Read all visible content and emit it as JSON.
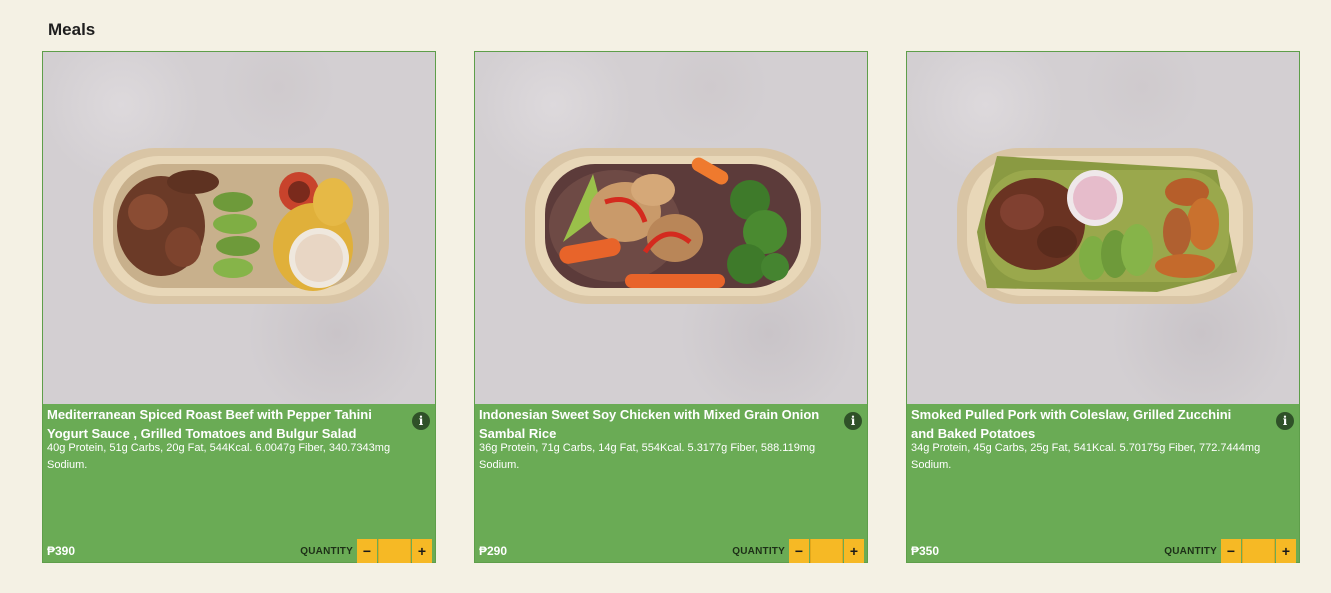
{
  "section": {
    "title": "Meals"
  },
  "meals": [
    {
      "title": "Mediterranean Spiced Roast Beef with Pepper Tahini Yogurt Sauce , Grilled Tomatoes and Bulgur Salad",
      "nutrition": "40g Protein, 51g Carbs, 20g Fat, 544Kcal. 6.0047g Fiber, 340.7343mg Sodium.",
      "price": "₱390",
      "quantity_label": "QUANTITY",
      "quantity_value": "",
      "minus": "−",
      "plus": "+",
      "info": "i"
    },
    {
      "title": "Indonesian Sweet Soy Chicken with Mixed Grain Onion Sambal Rice",
      "nutrition": "36g Protein, 71g Carbs, 14g Fat, 554Kcal. 5.3177g Fiber, 588.119mg Sodium.",
      "price": "₱290",
      "quantity_label": "QUANTITY",
      "quantity_value": "",
      "minus": "−",
      "plus": "+",
      "info": "i"
    },
    {
      "title": "Smoked Pulled Pork with Coleslaw, Grilled Zucchini and Baked Potatoes",
      "nutrition": "34g Protein, 45g Carbs, 25g Fat, 541Kcal. 5.70175g Fiber, 772.7444mg Sodium.",
      "price": "₱350",
      "quantity_label": "QUANTITY",
      "quantity_value": "",
      "minus": "−",
      "plus": "+",
      "info": "i"
    }
  ],
  "colors": {
    "background": "#f4f1e4",
    "card_green": "#6aab55",
    "qty_yellow": "#f6b925"
  }
}
